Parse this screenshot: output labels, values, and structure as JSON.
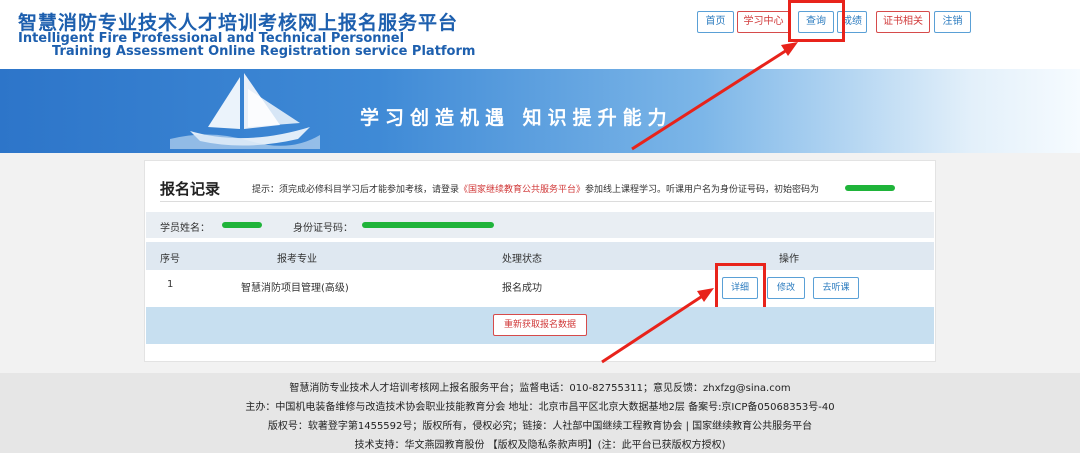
{
  "header": {
    "title_cn": "智慧消防专业技术人才培训考核网上报名服务平台",
    "title_en_line1": "Intelligent Fire Professional and Technical Personnel",
    "title_en_line2": "Training Assessment Online Registration service Platform"
  },
  "nav": [
    {
      "label": "首页"
    },
    {
      "label": "学习中心"
    },
    {
      "label": "查询"
    },
    {
      "label": "成绩"
    },
    {
      "label": "证书相关"
    },
    {
      "label": "注销"
    }
  ],
  "banner": {
    "slogan": "学习创造机遇  知识提升能力"
  },
  "records": {
    "title": "报名记录",
    "hint_prefix": "提示：须完成必修科目学习后才能参加考核，请登录",
    "hint_link": "《国家继续教育公共服务平台》",
    "hint_suffix": "参加线上课程学习。听课用户名为身份证号码，初始密码为",
    "student_name_label": "学员姓名：",
    "id_label": "身份证号码：",
    "columns": [
      "序号",
      "报考专业",
      "处理状态",
      "操作"
    ],
    "rows": [
      {
        "no": "1",
        "major": "智慧消防项目管理(高级)",
        "status": "报名成功"
      }
    ],
    "actions": {
      "detail": "详细",
      "edit": "修改",
      "listen": "去听课"
    },
    "refresh": "重新获取报名数据"
  },
  "footer": {
    "line1": "智慧消防专业技术人才培训考核网上报名服务平台；监督电话：010-82755311；意见反馈：zhxfzg@sina.com",
    "line2": "主办：中国机电装备维修与改造技术协会职业技能教育分会 地址：北京市昌平区北京大数据基地2层 备案号:京ICP备05068353号-40",
    "line3": "版权号：软著登字第1455592号；版权所有，侵权必究；链接：人社部中国继续工程教育协会 | 国家继续教育公共服务平台",
    "line4": "技术支持：华文燕园教育股份 【版权及隐私条款声明】(注：此平台已获版权方授权)"
  },
  "colors": {
    "brand_blue": "#1d5fae",
    "highlight_red": "#e8231b",
    "redact_green": "#1fb43a"
  }
}
